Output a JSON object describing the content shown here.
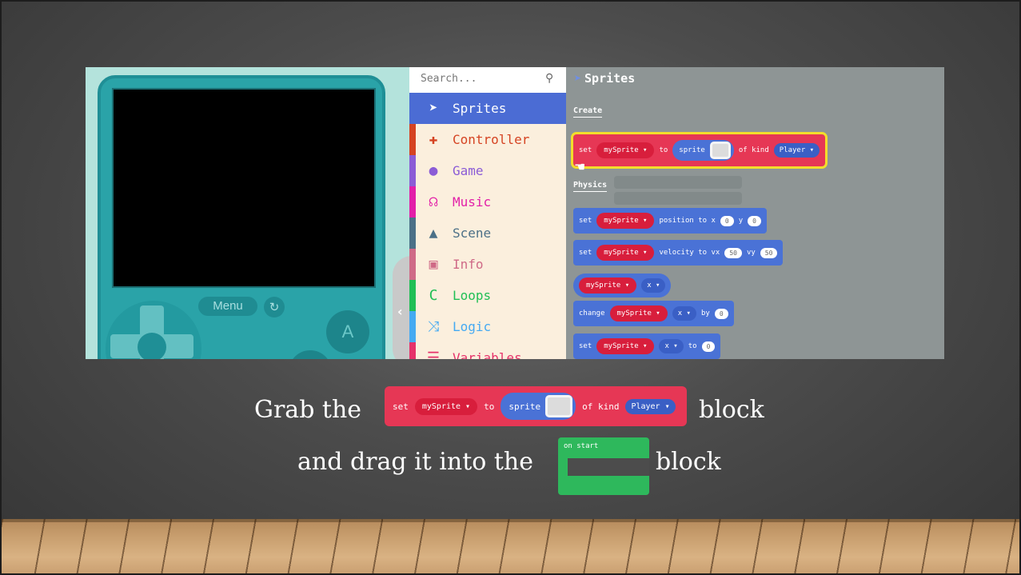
{
  "simulator": {
    "menu_label": "Menu",
    "a_label": "A"
  },
  "toolbox": {
    "search_placeholder": "Search...",
    "categories": [
      {
        "label": "Sprites",
        "color": "#4b6cd4",
        "icon": "paper-plane-icon"
      },
      {
        "label": "Controller",
        "color": "#d54322",
        "icon": "gamepad-icon"
      },
      {
        "label": "Game",
        "color": "#8b5cd6",
        "icon": "circle-icon"
      },
      {
        "label": "Music",
        "color": "#e21fa8",
        "icon": "headphones-icon"
      },
      {
        "label": "Scene",
        "color": "#4b7087",
        "icon": "tree-icon"
      },
      {
        "label": "Info",
        "color": "#cf6a87",
        "icon": "id-card-icon"
      },
      {
        "label": "Loops",
        "color": "#20bf55",
        "icon": "loop-icon"
      },
      {
        "label": "Logic",
        "color": "#45aaf2",
        "icon": "shuffle-icon"
      },
      {
        "label": "Variables",
        "color": "#e6326a",
        "icon": "list-icon"
      }
    ]
  },
  "workspace": {
    "title": "Sprites",
    "section_create": "Create",
    "section_physics": "Physics",
    "blocks": {
      "set": "set",
      "to": "to",
      "my_sprite": "mySprite ▾",
      "sprite": "sprite",
      "of_kind": "of kind",
      "player": "Player ▾",
      "position_to_x": "position to x",
      "y": "y",
      "velocity_to_vx": "velocity to vx",
      "vy": "vy",
      "x_dd": "x ▾",
      "change": "change",
      "by": "by",
      "zero": "0",
      "fifty": "50"
    }
  },
  "instructions": {
    "grab_the": "Grab the",
    "block": "block",
    "and_drag": "and drag it into the",
    "block2": "block",
    "on_start": "on start"
  }
}
